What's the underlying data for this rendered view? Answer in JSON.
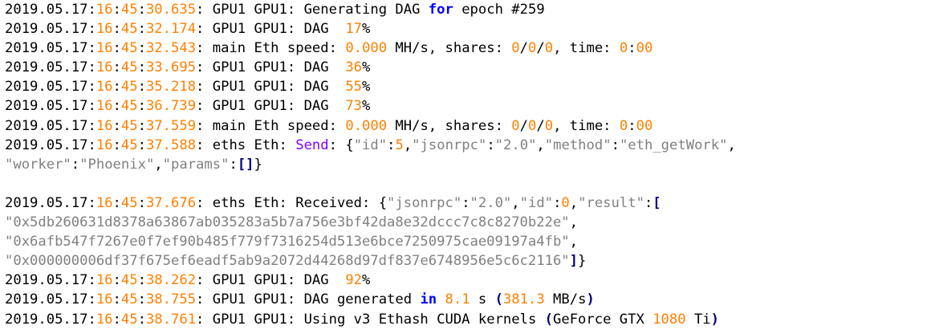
{
  "colors": {
    "default": "#000000",
    "number": "#ff8000",
    "keyword": "#0000ff",
    "function": "#8000ff",
    "string": "#808080",
    "bracket": "#000080",
    "background": "#ffffff"
  },
  "log": {
    "lines": [
      {
        "kind": "text",
        "segments": [
          {
            "t": "2019.05.17:",
            "c": "n"
          },
          {
            "t": "16",
            "c": "o"
          },
          {
            "t": ":",
            "c": "n"
          },
          {
            "t": "45",
            "c": "o"
          },
          {
            "t": ":",
            "c": "n"
          },
          {
            "t": "30.635",
            "c": "o"
          },
          {
            "t": ": GPU1 GPU1: Generating DAG ",
            "c": "n"
          },
          {
            "t": "for",
            "c": "k"
          },
          {
            "t": " epoch #259",
            "c": "n"
          }
        ]
      },
      {
        "kind": "text",
        "segments": [
          {
            "t": "2019.05.17:",
            "c": "n"
          },
          {
            "t": "16",
            "c": "o"
          },
          {
            "t": ":",
            "c": "n"
          },
          {
            "t": "45",
            "c": "o"
          },
          {
            "t": ":",
            "c": "n"
          },
          {
            "t": "32.174",
            "c": "o"
          },
          {
            "t": ": GPU1 GPU1: DAG  ",
            "c": "n"
          },
          {
            "t": "17",
            "c": "o"
          },
          {
            "t": "%",
            "c": "n"
          }
        ]
      },
      {
        "kind": "text",
        "segments": [
          {
            "t": "2019.05.17:",
            "c": "n"
          },
          {
            "t": "16",
            "c": "o"
          },
          {
            "t": ":",
            "c": "n"
          },
          {
            "t": "45",
            "c": "o"
          },
          {
            "t": ":",
            "c": "n"
          },
          {
            "t": "32.543",
            "c": "o"
          },
          {
            "t": ": main Eth speed: ",
            "c": "n"
          },
          {
            "t": "0.000",
            "c": "o"
          },
          {
            "t": " MH/s, shares: ",
            "c": "n"
          },
          {
            "t": "0",
            "c": "o"
          },
          {
            "t": "/",
            "c": "n"
          },
          {
            "t": "0",
            "c": "o"
          },
          {
            "t": "/",
            "c": "n"
          },
          {
            "t": "0",
            "c": "o"
          },
          {
            "t": ", time: ",
            "c": "n"
          },
          {
            "t": "0",
            "c": "o"
          },
          {
            "t": ":",
            "c": "n"
          },
          {
            "t": "00",
            "c": "o"
          }
        ]
      },
      {
        "kind": "text",
        "segments": [
          {
            "t": "2019.05.17:",
            "c": "n"
          },
          {
            "t": "16",
            "c": "o"
          },
          {
            "t": ":",
            "c": "n"
          },
          {
            "t": "45",
            "c": "o"
          },
          {
            "t": ":",
            "c": "n"
          },
          {
            "t": "33.695",
            "c": "o"
          },
          {
            "t": ": GPU1 GPU1: DAG  ",
            "c": "n"
          },
          {
            "t": "36",
            "c": "o"
          },
          {
            "t": "%",
            "c": "n"
          }
        ]
      },
      {
        "kind": "text",
        "segments": [
          {
            "t": "2019.05.17:",
            "c": "n"
          },
          {
            "t": "16",
            "c": "o"
          },
          {
            "t": ":",
            "c": "n"
          },
          {
            "t": "45",
            "c": "o"
          },
          {
            "t": ":",
            "c": "n"
          },
          {
            "t": "35.218",
            "c": "o"
          },
          {
            "t": ": GPU1 GPU1: DAG  ",
            "c": "n"
          },
          {
            "t": "55",
            "c": "o"
          },
          {
            "t": "%",
            "c": "n"
          }
        ]
      },
      {
        "kind": "text",
        "segments": [
          {
            "t": "2019.05.17:",
            "c": "n"
          },
          {
            "t": "16",
            "c": "o"
          },
          {
            "t": ":",
            "c": "n"
          },
          {
            "t": "45",
            "c": "o"
          },
          {
            "t": ":",
            "c": "n"
          },
          {
            "t": "36.739",
            "c": "o"
          },
          {
            "t": ": GPU1 GPU1: DAG  ",
            "c": "n"
          },
          {
            "t": "73",
            "c": "o"
          },
          {
            "t": "%",
            "c": "n"
          }
        ]
      },
      {
        "kind": "text",
        "segments": [
          {
            "t": "2019.05.17:",
            "c": "n"
          },
          {
            "t": "16",
            "c": "o"
          },
          {
            "t": ":",
            "c": "n"
          },
          {
            "t": "45",
            "c": "o"
          },
          {
            "t": ":",
            "c": "n"
          },
          {
            "t": "37.559",
            "c": "o"
          },
          {
            "t": ": main Eth speed: ",
            "c": "n"
          },
          {
            "t": "0.000",
            "c": "o"
          },
          {
            "t": " MH/s, shares: ",
            "c": "n"
          },
          {
            "t": "0",
            "c": "o"
          },
          {
            "t": "/",
            "c": "n"
          },
          {
            "t": "0",
            "c": "o"
          },
          {
            "t": "/",
            "c": "n"
          },
          {
            "t": "0",
            "c": "o"
          },
          {
            "t": ", time: ",
            "c": "n"
          },
          {
            "t": "0",
            "c": "o"
          },
          {
            "t": ":",
            "c": "n"
          },
          {
            "t": "00",
            "c": "o"
          }
        ]
      },
      {
        "kind": "text",
        "segments": [
          {
            "t": "2019.05.17:",
            "c": "n"
          },
          {
            "t": "16",
            "c": "o"
          },
          {
            "t": ":",
            "c": "n"
          },
          {
            "t": "45",
            "c": "o"
          },
          {
            "t": ":",
            "c": "n"
          },
          {
            "t": "37.588",
            "c": "o"
          },
          {
            "t": ": eths Eth: ",
            "c": "n"
          },
          {
            "t": "Send",
            "c": "p"
          },
          {
            "t": ": {",
            "c": "n"
          },
          {
            "t": "\"id\"",
            "c": "s"
          },
          {
            "t": ":",
            "c": "n"
          },
          {
            "t": "5",
            "c": "o"
          },
          {
            "t": ",",
            "c": "n"
          },
          {
            "t": "\"jsonrpc\"",
            "c": "s"
          },
          {
            "t": ":",
            "c": "n"
          },
          {
            "t": "\"2.0\"",
            "c": "s"
          },
          {
            "t": ",",
            "c": "n"
          },
          {
            "t": "\"method\"",
            "c": "s"
          },
          {
            "t": ":",
            "c": "n"
          },
          {
            "t": "\"eth_getWork\"",
            "c": "s"
          },
          {
            "t": ",",
            "c": "n"
          }
        ]
      },
      {
        "kind": "text",
        "segments": [
          {
            "t": "\"worker\"",
            "c": "s"
          },
          {
            "t": ":",
            "c": "n"
          },
          {
            "t": "\"Phoenix\"",
            "c": "s"
          },
          {
            "t": ",",
            "c": "n"
          },
          {
            "t": "\"params\"",
            "c": "s"
          },
          {
            "t": ":",
            "c": "n"
          },
          {
            "t": "[]",
            "c": "b"
          },
          {
            "t": "}",
            "c": "n"
          }
        ]
      },
      {
        "kind": "blank",
        "segments": []
      },
      {
        "kind": "text",
        "segments": [
          {
            "t": "2019.05.17:",
            "c": "n"
          },
          {
            "t": "16",
            "c": "o"
          },
          {
            "t": ":",
            "c": "n"
          },
          {
            "t": "45",
            "c": "o"
          },
          {
            "t": ":",
            "c": "n"
          },
          {
            "t": "37.676",
            "c": "o"
          },
          {
            "t": ": eths Eth: Received: {",
            "c": "n"
          },
          {
            "t": "\"jsonrpc\"",
            "c": "s"
          },
          {
            "t": ":",
            "c": "n"
          },
          {
            "t": "\"2.0\"",
            "c": "s"
          },
          {
            "t": ",",
            "c": "n"
          },
          {
            "t": "\"id\"",
            "c": "s"
          },
          {
            "t": ":",
            "c": "n"
          },
          {
            "t": "0",
            "c": "o"
          },
          {
            "t": ",",
            "c": "n"
          },
          {
            "t": "\"result\"",
            "c": "s"
          },
          {
            "t": ":",
            "c": "n"
          },
          {
            "t": "[",
            "c": "b"
          }
        ]
      },
      {
        "kind": "text",
        "segments": [
          {
            "t": "\"0x5db260631d8378a63867ab035283a5b7a756e3bf42da8e32dccc7c8c8270b22e\"",
            "c": "s"
          },
          {
            "t": ",",
            "c": "n"
          }
        ]
      },
      {
        "kind": "text",
        "segments": [
          {
            "t": "\"0x6afb547f7267e0f7ef90b485f779f7316254d513e6bce7250975cae09197a4fb\"",
            "c": "s"
          },
          {
            "t": ",",
            "c": "n"
          }
        ]
      },
      {
        "kind": "text",
        "segments": [
          {
            "t": "\"0x000000006df37f675ef6eadf5ab9a2072d44268d97df837e6748956e5c6c2116\"",
            "c": "s"
          },
          {
            "t": "]",
            "c": "b"
          },
          {
            "t": "}",
            "c": "n"
          }
        ]
      },
      {
        "kind": "text",
        "segments": [
          {
            "t": "2019.05.17:",
            "c": "n"
          },
          {
            "t": "16",
            "c": "o"
          },
          {
            "t": ":",
            "c": "n"
          },
          {
            "t": "45",
            "c": "o"
          },
          {
            "t": ":",
            "c": "n"
          },
          {
            "t": "38.262",
            "c": "o"
          },
          {
            "t": ": GPU1 GPU1: DAG  ",
            "c": "n"
          },
          {
            "t": "92",
            "c": "o"
          },
          {
            "t": "%",
            "c": "n"
          }
        ]
      },
      {
        "kind": "text",
        "segments": [
          {
            "t": "2019.05.17:",
            "c": "n"
          },
          {
            "t": "16",
            "c": "o"
          },
          {
            "t": ":",
            "c": "n"
          },
          {
            "t": "45",
            "c": "o"
          },
          {
            "t": ":",
            "c": "n"
          },
          {
            "t": "38.755",
            "c": "o"
          },
          {
            "t": ": GPU1 GPU1: DAG generated ",
            "c": "n"
          },
          {
            "t": "in",
            "c": "k"
          },
          {
            "t": " ",
            "c": "n"
          },
          {
            "t": "8.1",
            "c": "o"
          },
          {
            "t": " s ",
            "c": "n"
          },
          {
            "t": "(",
            "c": "b"
          },
          {
            "t": "381.3",
            "c": "o"
          },
          {
            "t": " MB/s",
            "c": "n"
          },
          {
            "t": ")",
            "c": "b"
          }
        ]
      },
      {
        "kind": "text",
        "segments": [
          {
            "t": "2019.05.17:",
            "c": "n"
          },
          {
            "t": "16",
            "c": "o"
          },
          {
            "t": ":",
            "c": "n"
          },
          {
            "t": "45",
            "c": "o"
          },
          {
            "t": ":",
            "c": "n"
          },
          {
            "t": "38.761",
            "c": "o"
          },
          {
            "t": ": GPU1 GPU1: Using v3 Ethash CUDA kernels ",
            "c": "n"
          },
          {
            "t": "(",
            "c": "b"
          },
          {
            "t": "GeForce GTX ",
            "c": "n"
          },
          {
            "t": "1080",
            "c": "o"
          },
          {
            "t": " Ti",
            "c": "n"
          },
          {
            "t": ")",
            "c": "b"
          }
        ]
      }
    ]
  }
}
